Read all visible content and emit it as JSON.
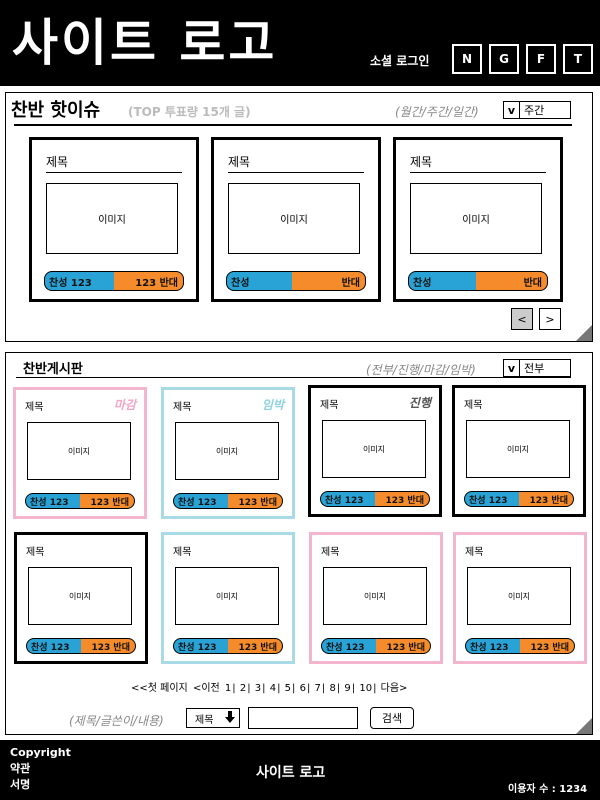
{
  "header": {
    "logo": "사이트 로고",
    "social_label": "소셜 로그인",
    "social_buttons": [
      "N",
      "G",
      "F",
      "T"
    ]
  },
  "hot": {
    "title": "찬반 핫이슈",
    "subtitle": "(TOP 투표량 15개 글)",
    "period_filter": "(월간/주간/일간)",
    "select_icon": "v",
    "select_value": "주간",
    "cards": [
      {
        "title": "제목",
        "image": "이미지",
        "agree": "찬성 123",
        "disagree": "123 반대"
      },
      {
        "title": "제목",
        "image": "이미지",
        "agree": "찬성",
        "disagree": "반대"
      },
      {
        "title": "제목",
        "image": "이미지",
        "agree": "찬성",
        "disagree": "반대"
      }
    ],
    "prev": "<",
    "next": ">"
  },
  "board": {
    "title": "찬반게시판",
    "filter": "(전부/진행/마감/임박)",
    "select_icon": "v",
    "select_value": "전부",
    "cards": [
      {
        "title": "제목",
        "status": "마감",
        "image": "이미지",
        "agree": "찬성 123",
        "disagree": "123 반대",
        "border": "#f4b6cf",
        "status_color": "#f4a6c6"
      },
      {
        "title": "제목",
        "status": "임박",
        "image": "이미지",
        "agree": "찬성 123",
        "disagree": "123 반대",
        "border": "#a8dbe6",
        "status_color": "#8fd3e0"
      },
      {
        "title": "제목",
        "status": "진행",
        "image": "이미지",
        "agree": "찬성 123",
        "disagree": "123 반대",
        "border": "#000000",
        "status_color": "#555555"
      },
      {
        "title": "제목",
        "status": "",
        "image": "이미지",
        "agree": "찬성 123",
        "disagree": "123 반대",
        "border": "#000000",
        "status_color": "#555555"
      },
      {
        "title": "제목",
        "status": "",
        "image": "이미지",
        "agree": "찬성 123",
        "disagree": "123 반대",
        "border": "#000000",
        "status_color": "#555555"
      },
      {
        "title": "제목",
        "status": "",
        "image": "이미지",
        "agree": "찬성 123",
        "disagree": "123 반대",
        "border": "#a8dbe6",
        "status_color": "#8fd3e0"
      },
      {
        "title": "제목",
        "status": "",
        "image": "이미지",
        "agree": "찬성 123",
        "disagree": "123 반대",
        "border": "#f4b6cf",
        "status_color": "#f4a6c6"
      },
      {
        "title": "제목",
        "status": "",
        "image": "이미지",
        "agree": "찬성 123",
        "disagree": "123 반대",
        "border": "#f4b6cf",
        "status_color": "#f4a6c6"
      }
    ],
    "pagination": {
      "first": "<<첫 페이지",
      "prev": "<이전",
      "pages": [
        "1",
        "2",
        "3",
        "4",
        "5",
        "6",
        "7",
        "8",
        "9",
        "10"
      ],
      "next": "다음>"
    },
    "search": {
      "label": "(제목/글쓴이/내용)",
      "select_value": "제목",
      "select_icon": "down-arrow-icon",
      "button": "검색"
    }
  },
  "footer": {
    "links": [
      "Copyright",
      "약관",
      "서명"
    ],
    "logo": "사이트 로고",
    "visitors": "이용자 수 : 1234"
  },
  "colors": {
    "agree": "#29a3d6",
    "disagree": "#f58b2a",
    "pink": "#f4b6cf",
    "sky": "#a8dbe6"
  }
}
